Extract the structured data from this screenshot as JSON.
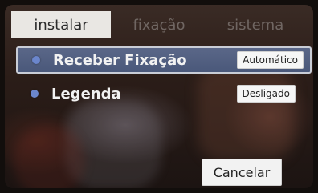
{
  "tabs": [
    {
      "label": "instalar",
      "active": true
    },
    {
      "label": "fixação",
      "active": false
    },
    {
      "label": "sistema",
      "active": false
    }
  ],
  "menu": {
    "items": [
      {
        "label": "Receber Fixação",
        "value": "Automático",
        "selected": true
      },
      {
        "label": "Legenda",
        "value": "Desligado",
        "selected": false
      }
    ]
  },
  "actions": {
    "cancel_label": "Cancelar"
  },
  "colors": {
    "accent": "#4a587a",
    "bullet": "#6b86cc",
    "tab_active_bg": "#e9e7e3"
  }
}
